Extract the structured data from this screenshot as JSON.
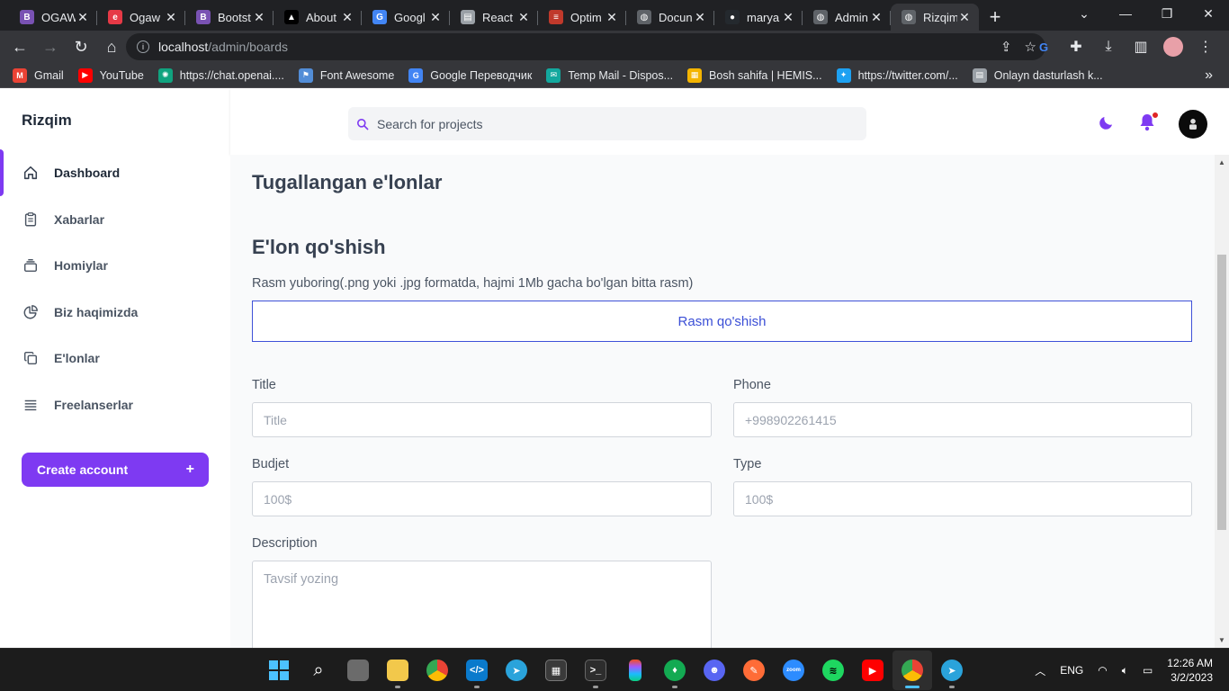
{
  "browser": {
    "tabs": [
      {
        "title": "OGAW",
        "icon": "bootstrap-icon",
        "color": "#7952b3",
        "glyph": "B"
      },
      {
        "title": "Ogaw",
        "icon": "ogaw-icon",
        "color": "#e63946",
        "glyph": "e"
      },
      {
        "title": "Bootst",
        "icon": "bootstrap-icon",
        "color": "#7952b3",
        "glyph": "B"
      },
      {
        "title": "About",
        "icon": "vercel-icon",
        "color": "#000000",
        "glyph": "▲"
      },
      {
        "title": "Googl",
        "icon": "google-translate-icon",
        "color": "#4285f4",
        "glyph": "G"
      },
      {
        "title": "React",
        "icon": "page-icon",
        "color": "#9aa0a6",
        "glyph": "▤"
      },
      {
        "title": "Optim",
        "icon": "optim-icon",
        "color": "#c0392b",
        "glyph": "≡"
      },
      {
        "title": "Docun",
        "icon": "globe-icon",
        "color": "#5f6368",
        "glyph": "◍"
      },
      {
        "title": "marya",
        "icon": "github-icon",
        "color": "#24292e",
        "glyph": "●"
      },
      {
        "title": "Admin",
        "icon": "globe-icon",
        "color": "#5f6368",
        "glyph": "◍"
      },
      {
        "title": "Rizqim",
        "icon": "globe-icon",
        "color": "#5f6368",
        "glyph": "◍",
        "active": true
      }
    ],
    "url_host": "localhost",
    "url_path": "/admin/boards",
    "bookmarks": [
      {
        "label": "Gmail",
        "icon": "gmail-icon",
        "color": "#ea4335",
        "glyph": "M"
      },
      {
        "label": "YouTube",
        "icon": "youtube-icon",
        "color": "#ff0000",
        "glyph": "▶"
      },
      {
        "label": "https://chat.openai....",
        "icon": "openai-icon",
        "color": "#10a37f",
        "glyph": "✺"
      },
      {
        "label": "Font Awesome",
        "icon": "flag-icon",
        "color": "#528dd7",
        "glyph": "⚑"
      },
      {
        "label": "Google Переводчик",
        "icon": "google-translate-icon",
        "color": "#4285f4",
        "glyph": "G"
      },
      {
        "label": "Temp Mail - Dispos...",
        "icon": "tempmail-icon",
        "color": "#13a89e",
        "glyph": "✉"
      },
      {
        "label": "Bosh sahifa | HEMIS...",
        "icon": "hemis-icon",
        "color": "#f4b400",
        "glyph": "▦"
      },
      {
        "label": "https://twitter.com/...",
        "icon": "twitter-icon",
        "color": "#1da1f2",
        "glyph": "✦"
      },
      {
        "label": "Onlayn dasturlash k...",
        "icon": "page-icon",
        "color": "#9aa0a6",
        "glyph": "▤"
      }
    ]
  },
  "app": {
    "brand": "Rizqim",
    "accent": "#7e3af2",
    "search_placeholder": "Search for projects",
    "nav": [
      {
        "label": "Dashboard",
        "icon": "home-icon",
        "active": true
      },
      {
        "label": "Xabarlar",
        "icon": "clipboard-icon"
      },
      {
        "label": "Homiylar",
        "icon": "stack-icon"
      },
      {
        "label": "Biz haqimizda",
        "icon": "pie-chart-icon"
      },
      {
        "label": "E'lonlar",
        "icon": "copy-icon"
      },
      {
        "label": "Freelanserlar",
        "icon": "menu-lines-icon"
      }
    ],
    "create_account": "Create account",
    "create_plus": "+"
  },
  "main": {
    "title": "Tugallangan e'lonlar",
    "subtitle": "E'lon qo'shish",
    "upload_label": "Rasm yuboring(.png yoki .jpg formatda, hajmi 1Mb gacha bo'lgan bitta rasm)",
    "upload_button": "Rasm qo'shish",
    "form": {
      "title_label": "Title",
      "title_placeholder": "Title",
      "phone_label": "Phone",
      "phone_placeholder": "+998902261415",
      "budget_label": "Budjet",
      "budget_placeholder": "100$",
      "type_label": "Type",
      "type_placeholder": "100$",
      "description_label": "Description",
      "description_placeholder": "Tavsif yozing"
    }
  },
  "taskbar": {
    "lang": "ENG",
    "time": "12:26 AM",
    "date": "3/2/2023"
  }
}
